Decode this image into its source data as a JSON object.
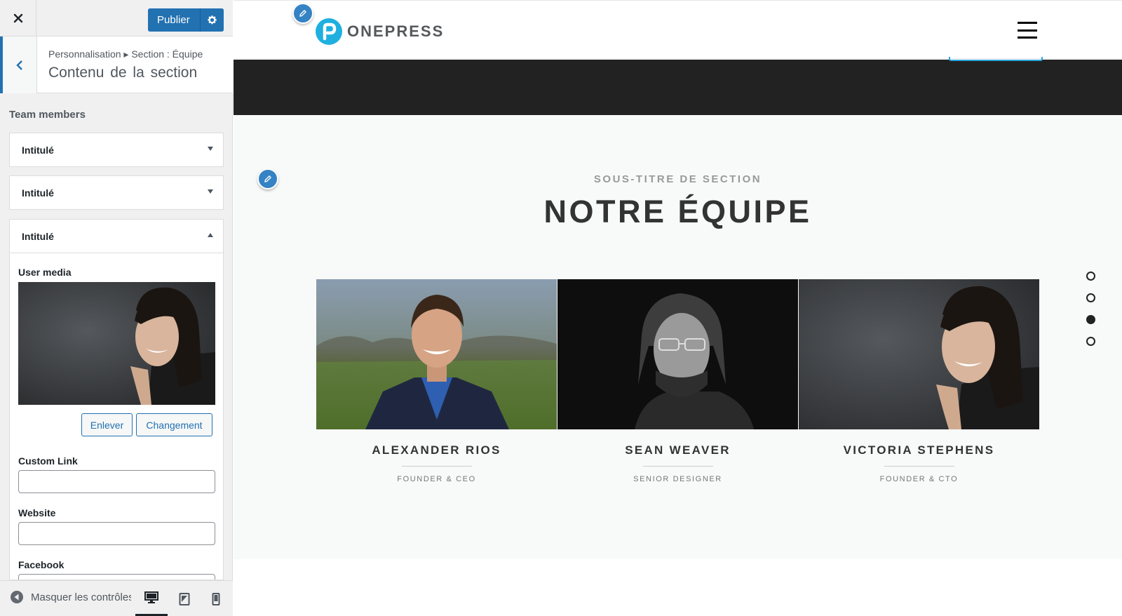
{
  "sidebar": {
    "publish_label": "Publier",
    "breadcrumb": "Personnalisation ▸ Section : Équipe",
    "section_title": "Contenu de la section",
    "team_label": "Team members",
    "items": [
      {
        "label": "Intitulé",
        "expanded": false
      },
      {
        "label": "Intitulé",
        "expanded": false
      },
      {
        "label": "Intitulé",
        "expanded": true
      }
    ],
    "expanded_item": {
      "user_media_label": "User media",
      "remove_label": "Enlever",
      "change_label": "Changement",
      "custom_link_label": "Custom Link",
      "custom_link_value": "",
      "website_label": "Website",
      "website_value": "",
      "facebook_label": "Facebook"
    },
    "footer": {
      "hide_controls_label": "Masquer les contrôles",
      "devices": [
        "desktop-icon",
        "tablet-icon",
        "mobile-icon"
      ],
      "active_device": "desktop"
    }
  },
  "preview": {
    "logo_text": "ONEPRESS",
    "section_subtitle": "SOUS-TITRE DE SECTION",
    "section_title": "NOTRE ÉQUIPE",
    "members": [
      {
        "name": "ALEXANDER RIOS",
        "role": "FOUNDER & CEO"
      },
      {
        "name": "SEAN WEAVER",
        "role": "SENIOR DESIGNER"
      },
      {
        "name": "VICTORIA STEPHENS",
        "role": "FOUNDER & CTO"
      }
    ],
    "nav_dots": 4,
    "active_dot": 3
  },
  "colors": {
    "wp_blue": "#2271b1",
    "logo_cyan": "#1fb0e0",
    "dark_band": "#222222",
    "section_bg": "#f8f9f9"
  }
}
